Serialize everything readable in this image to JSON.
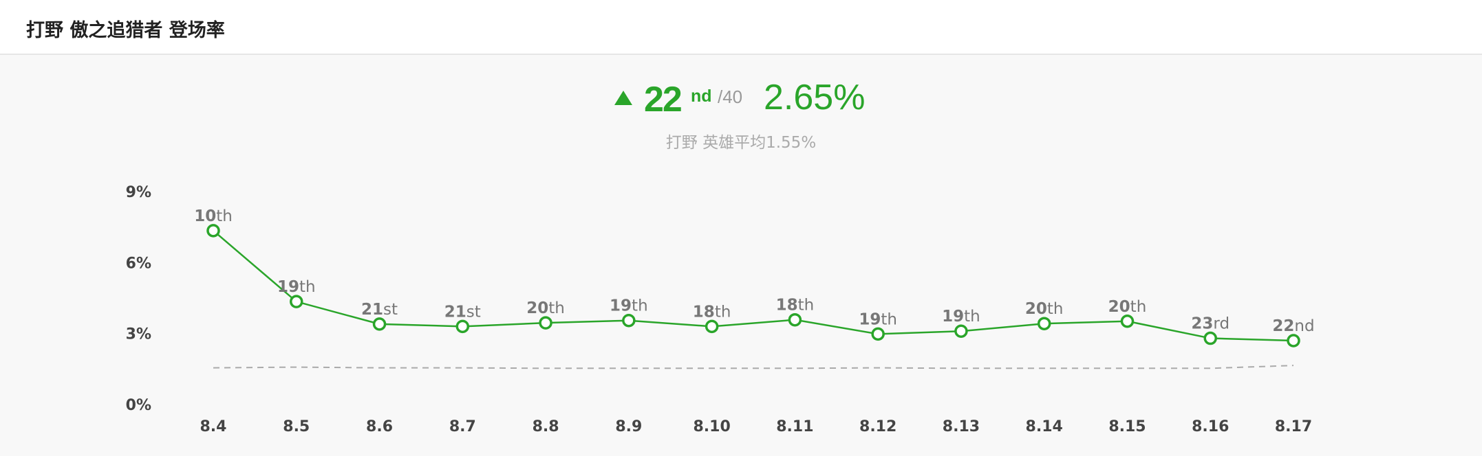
{
  "header": {
    "title": "打野 傲之追猎者 登场率"
  },
  "summary": {
    "trend": "up",
    "trend_icon": "triangle-up-icon",
    "rank": "22",
    "rank_suffix": "nd",
    "rank_total": "/40",
    "rate": "2.65%",
    "avg_label": "打野 英雄平均",
    "avg_value": "1.55%"
  },
  "colors": {
    "accent": "#2aa52a",
    "avg_line": "#aaaaaa",
    "muted": "#999999"
  },
  "chart_data": {
    "type": "line",
    "categories": [
      "8.4",
      "8.5",
      "8.6",
      "8.7",
      "8.8",
      "8.9",
      "8.10",
      "8.11",
      "8.12",
      "8.13",
      "8.14",
      "8.15",
      "8.16",
      "8.17"
    ],
    "series": [
      {
        "values": [
          7.35,
          4.35,
          3.4,
          3.3,
          3.45,
          3.55,
          3.3,
          3.58,
          2.98,
          3.1,
          3.42,
          3.52,
          2.8,
          2.7
        ],
        "rank_labels": [
          {
            "num": "10",
            "suf": "th"
          },
          {
            "num": "19",
            "suf": "th"
          },
          {
            "num": "21",
            "suf": "st"
          },
          {
            "num": "21",
            "suf": "st"
          },
          {
            "num": "20",
            "suf": "th"
          },
          {
            "num": "19",
            "suf": "th"
          },
          {
            "num": "18",
            "suf": "th"
          },
          {
            "num": "18",
            "suf": "th"
          },
          {
            "num": "19",
            "suf": "th"
          },
          {
            "num": "19",
            "suf": "th"
          },
          {
            "num": "20",
            "suf": "th"
          },
          {
            "num": "20",
            "suf": "th"
          },
          {
            "num": "23",
            "suf": "rd"
          },
          {
            "num": "22",
            "suf": "nd"
          }
        ]
      },
      {
        "style": "dashed",
        "values": [
          1.55,
          1.58,
          1.55,
          1.55,
          1.53,
          1.53,
          1.53,
          1.53,
          1.55,
          1.53,
          1.53,
          1.53,
          1.53,
          1.65
        ]
      }
    ],
    "yticks": [
      "0%",
      "3%",
      "6%",
      "9%"
    ],
    "ytick_values": [
      0,
      3,
      6,
      9
    ],
    "ylim": [
      0,
      9
    ],
    "grid": false,
    "legend": "none"
  }
}
